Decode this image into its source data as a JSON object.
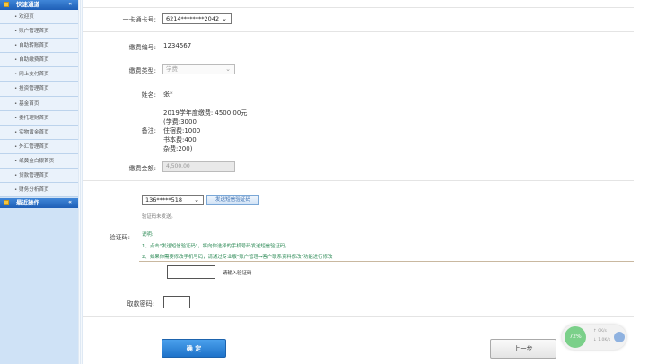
{
  "sidebar": {
    "section1_title": "快速通道",
    "section1_arrow": "«",
    "items": [
      {
        "label": "• 欢迎页"
      },
      {
        "label": "• 账户管理首页"
      },
      {
        "label": "• 自助转账首页"
      },
      {
        "label": "• 自助缴费首页"
      },
      {
        "label": "• 网上支付首页"
      },
      {
        "label": "• 投资管理首页"
      },
      {
        "label": "• 基金首页"
      },
      {
        "label": "• 委托理财首页"
      },
      {
        "label": "• 实物黄金首页"
      },
      {
        "label": "• 外汇管理首页"
      },
      {
        "label": "• 纸黄金白银首页"
      },
      {
        "label": "• 贷款管理首页"
      },
      {
        "label": "• 财务分析首页"
      }
    ],
    "section2_title": "最近操作",
    "section2_arrow": "«"
  },
  "form": {
    "card_label": "一卡通卡号:",
    "card_value": "6214********2042",
    "payno_label": "缴费编号:",
    "payno_value": "1234567",
    "paytype_label": "缴费类型:",
    "paytype_value": "学费",
    "name_label": "姓名:",
    "name_value": "张*",
    "remark_label": "备注:",
    "remark_lines": [
      "2019学年度缴费: 4500.00元",
      "(学费:3000",
      "住宿费:1000",
      "书本费:400",
      "杂费:200)"
    ],
    "amount_label": "缴费金额:",
    "amount_value": "4,500.00",
    "phone_value": "136*****518",
    "send_sms_button": "发送短信验证码",
    "sms_not_sent": "验证码未发送。",
    "code_label": "验证码:",
    "note_title": "说明:",
    "note_1": "1、点击\"发送短信验证码\"，将向你选择的手机号码发送短信验证码。",
    "note_2": "2、如果你需要修改手机号码，请通过专业版\"账户管理→客户联系资料修改\"功能进行修改",
    "code_placeholder_hint": "请输入验证码",
    "withdraw_pwd_label": "取款密码:",
    "confirm_button": "确 定",
    "prev_button": "上一步"
  },
  "widget": {
    "percent": "72%",
    "line1": "↑ 0K/s",
    "line2": "↓ 1.0K/s"
  }
}
